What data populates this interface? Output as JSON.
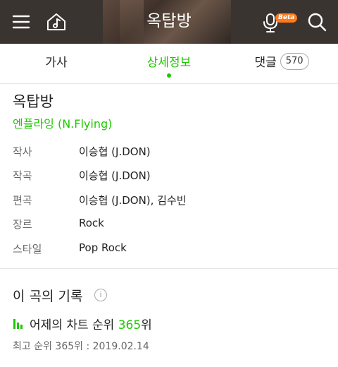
{
  "header": {
    "title": "옥탑방",
    "beta_badge": "Beta",
    "icons": [
      "menu-icon",
      "home-music-icon",
      "mic-icon",
      "search-icon"
    ]
  },
  "tabs": [
    {
      "label": "가사"
    },
    {
      "label": "상세정보",
      "active": true
    },
    {
      "label": "댓글",
      "count": "570"
    }
  ],
  "song": {
    "title": "옥탑방",
    "artist": "엔플라잉 (N.Flying)",
    "details": [
      {
        "label": "작사",
        "value": "이승협 (J.DON)"
      },
      {
        "label": "작곡",
        "value": "이승협 (J.DON)"
      },
      {
        "label": "편곡",
        "value": "이승협 (J.DON), 김수빈"
      },
      {
        "label": "장르",
        "value": "Rock"
      },
      {
        "label": "스타일",
        "value": "Pop Rock"
      }
    ]
  },
  "records": {
    "title": "이 곡의 기록",
    "info_icon": "i",
    "chart_prefix": "어제의 차트 순위",
    "chart_rank": "365",
    "chart_suffix": "위",
    "best": "최고 순위 365위 : 2019.02.14"
  },
  "colors": {
    "accent": "#1ec800",
    "header_bg": "#3a3431",
    "beta": "#ff7a1a"
  }
}
